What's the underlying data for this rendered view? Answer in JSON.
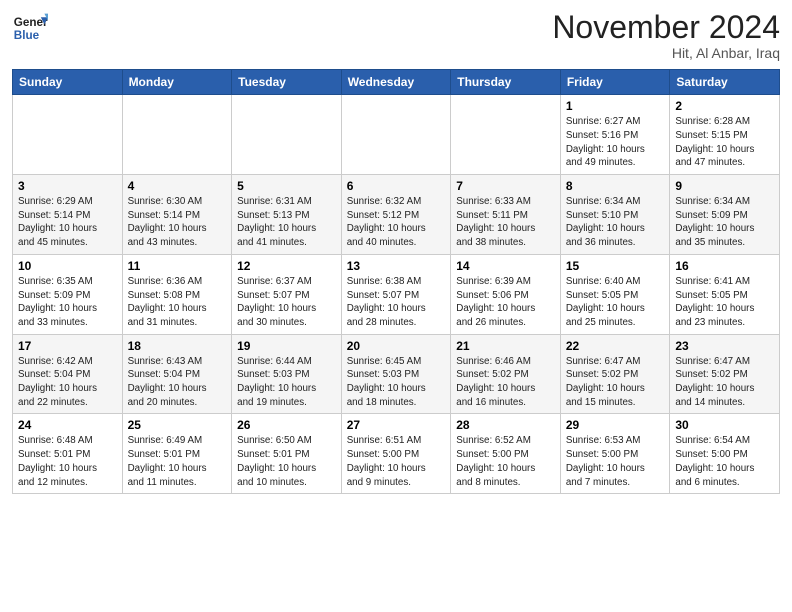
{
  "header": {
    "logo_line1": "General",
    "logo_line2": "Blue",
    "month_title": "November 2024",
    "location": "Hit, Al Anbar, Iraq"
  },
  "weekdays": [
    "Sunday",
    "Monday",
    "Tuesday",
    "Wednesday",
    "Thursday",
    "Friday",
    "Saturday"
  ],
  "weeks": [
    [
      {
        "day": "",
        "info": ""
      },
      {
        "day": "",
        "info": ""
      },
      {
        "day": "",
        "info": ""
      },
      {
        "day": "",
        "info": ""
      },
      {
        "day": "",
        "info": ""
      },
      {
        "day": "1",
        "info": "Sunrise: 6:27 AM\nSunset: 5:16 PM\nDaylight: 10 hours\nand 49 minutes."
      },
      {
        "day": "2",
        "info": "Sunrise: 6:28 AM\nSunset: 5:15 PM\nDaylight: 10 hours\nand 47 minutes."
      }
    ],
    [
      {
        "day": "3",
        "info": "Sunrise: 6:29 AM\nSunset: 5:14 PM\nDaylight: 10 hours\nand 45 minutes."
      },
      {
        "day": "4",
        "info": "Sunrise: 6:30 AM\nSunset: 5:14 PM\nDaylight: 10 hours\nand 43 minutes."
      },
      {
        "day": "5",
        "info": "Sunrise: 6:31 AM\nSunset: 5:13 PM\nDaylight: 10 hours\nand 41 minutes."
      },
      {
        "day": "6",
        "info": "Sunrise: 6:32 AM\nSunset: 5:12 PM\nDaylight: 10 hours\nand 40 minutes."
      },
      {
        "day": "7",
        "info": "Sunrise: 6:33 AM\nSunset: 5:11 PM\nDaylight: 10 hours\nand 38 minutes."
      },
      {
        "day": "8",
        "info": "Sunrise: 6:34 AM\nSunset: 5:10 PM\nDaylight: 10 hours\nand 36 minutes."
      },
      {
        "day": "9",
        "info": "Sunrise: 6:34 AM\nSunset: 5:09 PM\nDaylight: 10 hours\nand 35 minutes."
      }
    ],
    [
      {
        "day": "10",
        "info": "Sunrise: 6:35 AM\nSunset: 5:09 PM\nDaylight: 10 hours\nand 33 minutes."
      },
      {
        "day": "11",
        "info": "Sunrise: 6:36 AM\nSunset: 5:08 PM\nDaylight: 10 hours\nand 31 minutes."
      },
      {
        "day": "12",
        "info": "Sunrise: 6:37 AM\nSunset: 5:07 PM\nDaylight: 10 hours\nand 30 minutes."
      },
      {
        "day": "13",
        "info": "Sunrise: 6:38 AM\nSunset: 5:07 PM\nDaylight: 10 hours\nand 28 minutes."
      },
      {
        "day": "14",
        "info": "Sunrise: 6:39 AM\nSunset: 5:06 PM\nDaylight: 10 hours\nand 26 minutes."
      },
      {
        "day": "15",
        "info": "Sunrise: 6:40 AM\nSunset: 5:05 PM\nDaylight: 10 hours\nand 25 minutes."
      },
      {
        "day": "16",
        "info": "Sunrise: 6:41 AM\nSunset: 5:05 PM\nDaylight: 10 hours\nand 23 minutes."
      }
    ],
    [
      {
        "day": "17",
        "info": "Sunrise: 6:42 AM\nSunset: 5:04 PM\nDaylight: 10 hours\nand 22 minutes."
      },
      {
        "day": "18",
        "info": "Sunrise: 6:43 AM\nSunset: 5:04 PM\nDaylight: 10 hours\nand 20 minutes."
      },
      {
        "day": "19",
        "info": "Sunrise: 6:44 AM\nSunset: 5:03 PM\nDaylight: 10 hours\nand 19 minutes."
      },
      {
        "day": "20",
        "info": "Sunrise: 6:45 AM\nSunset: 5:03 PM\nDaylight: 10 hours\nand 18 minutes."
      },
      {
        "day": "21",
        "info": "Sunrise: 6:46 AM\nSunset: 5:02 PM\nDaylight: 10 hours\nand 16 minutes."
      },
      {
        "day": "22",
        "info": "Sunrise: 6:47 AM\nSunset: 5:02 PM\nDaylight: 10 hours\nand 15 minutes."
      },
      {
        "day": "23",
        "info": "Sunrise: 6:47 AM\nSunset: 5:02 PM\nDaylight: 10 hours\nand 14 minutes."
      }
    ],
    [
      {
        "day": "24",
        "info": "Sunrise: 6:48 AM\nSunset: 5:01 PM\nDaylight: 10 hours\nand 12 minutes."
      },
      {
        "day": "25",
        "info": "Sunrise: 6:49 AM\nSunset: 5:01 PM\nDaylight: 10 hours\nand 11 minutes."
      },
      {
        "day": "26",
        "info": "Sunrise: 6:50 AM\nSunset: 5:01 PM\nDaylight: 10 hours\nand 10 minutes."
      },
      {
        "day": "27",
        "info": "Sunrise: 6:51 AM\nSunset: 5:00 PM\nDaylight: 10 hours\nand 9 minutes."
      },
      {
        "day": "28",
        "info": "Sunrise: 6:52 AM\nSunset: 5:00 PM\nDaylight: 10 hours\nand 8 minutes."
      },
      {
        "day": "29",
        "info": "Sunrise: 6:53 AM\nSunset: 5:00 PM\nDaylight: 10 hours\nand 7 minutes."
      },
      {
        "day": "30",
        "info": "Sunrise: 6:54 AM\nSunset: 5:00 PM\nDaylight: 10 hours\nand 6 minutes."
      }
    ]
  ]
}
